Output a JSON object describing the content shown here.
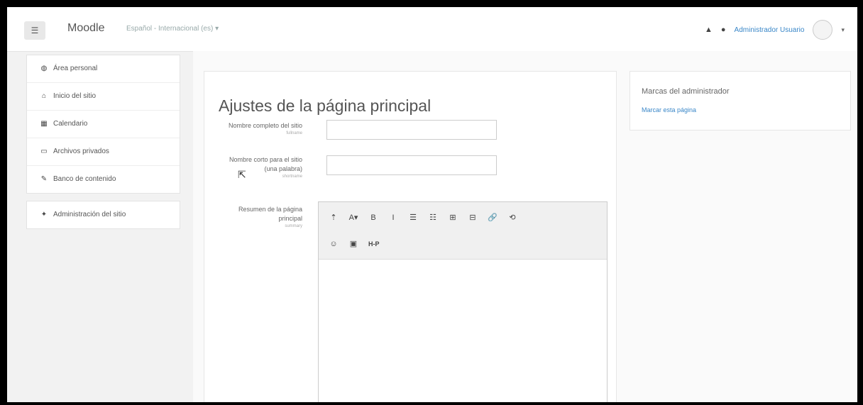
{
  "navbar": {
    "brand": "Moodle",
    "language": "Español - Internacional (es) ▾",
    "user_name": "Administrador Usuario",
    "icons": [
      "menu-icon",
      "bell-icon",
      "chat-icon",
      "avatar",
      "caret-icon"
    ]
  },
  "sidebar": {
    "group1": [
      {
        "label": "Área personal",
        "icon": "dashboard-icon"
      },
      {
        "label": "Inicio del sitio",
        "icon": "home-icon"
      },
      {
        "label": "Calendario",
        "icon": "calendar-icon"
      },
      {
        "label": "Archivos privados",
        "icon": "file-icon"
      },
      {
        "label": "Banco de contenido",
        "icon": "pencil-icon"
      }
    ],
    "group2": [
      {
        "label": "Administración del sitio",
        "icon": "wrench-icon"
      }
    ]
  },
  "main": {
    "title": "Ajustes de la página principal",
    "fields": [
      {
        "label": "Nombre completo del sitio",
        "sub": "fullname",
        "value": ""
      },
      {
        "label": "Nombre corto para el sitio (una palabra)",
        "sub": "shortname",
        "value": ""
      },
      {
        "label": "Resumen de la página principal",
        "sub": "summary",
        "value": ""
      }
    ],
    "toolbar": {
      "row1": [
        "⇡",
        "A▾",
        "B",
        "I",
        "☰",
        "☷",
        "⊞",
        "⊟",
        "🔗",
        "⟲"
      ],
      "row2": [
        "☺",
        "▣",
        "H-P"
      ]
    }
  },
  "right_block": {
    "title": "Marcas del administrador",
    "link": "Marcar esta página"
  }
}
